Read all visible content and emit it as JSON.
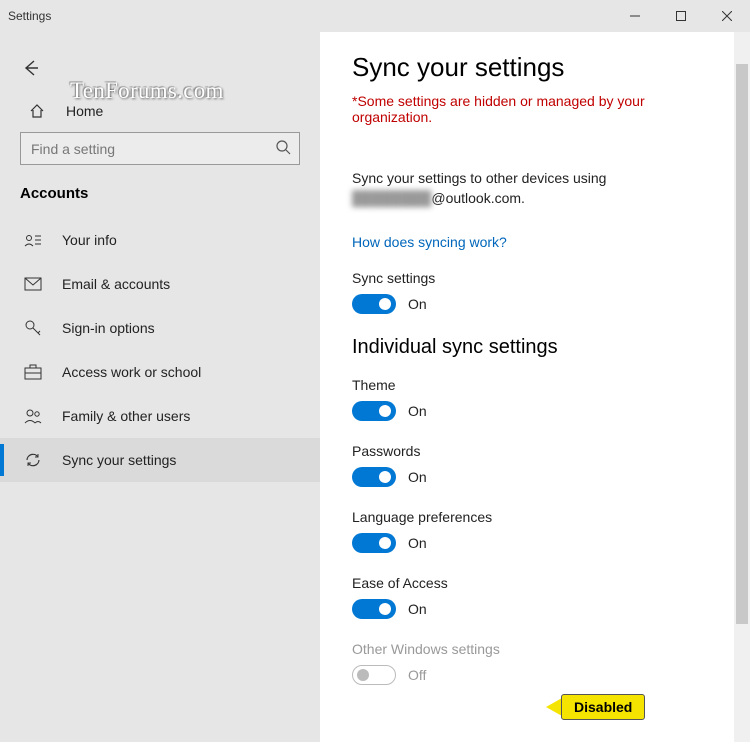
{
  "window": {
    "title": "Settings"
  },
  "sidebar": {
    "home_label": "Home",
    "search_placeholder": "Find a setting",
    "section_title": "Accounts",
    "items": [
      {
        "label": "Your info"
      },
      {
        "label": "Email & accounts"
      },
      {
        "label": "Sign-in options"
      },
      {
        "label": "Access work or school"
      },
      {
        "label": "Family & other users"
      },
      {
        "label": "Sync your settings"
      }
    ]
  },
  "main": {
    "heading": "Sync your settings",
    "alert": "*Some settings are hidden or managed by your organization.",
    "desc_pre": "Sync your settings to other devices using ",
    "desc_email_blurred": "████████",
    "desc_post": "@outlook.com.",
    "help_link": "How does syncing work?",
    "master_toggle": {
      "label": "Sync settings",
      "state": "On",
      "on": true
    },
    "individual_heading": "Individual sync settings",
    "individual": [
      {
        "label": "Theme",
        "state": "On",
        "on": true,
        "disabled": false
      },
      {
        "label": "Passwords",
        "state": "On",
        "on": true,
        "disabled": false
      },
      {
        "label": "Language preferences",
        "state": "On",
        "on": true,
        "disabled": false
      },
      {
        "label": "Ease of Access",
        "state": "On",
        "on": true,
        "disabled": false
      },
      {
        "label": "Other Windows settings",
        "state": "Off",
        "on": false,
        "disabled": true
      }
    ]
  },
  "callout": {
    "text": "Disabled"
  },
  "watermark": {
    "text": "TenForums.com"
  }
}
